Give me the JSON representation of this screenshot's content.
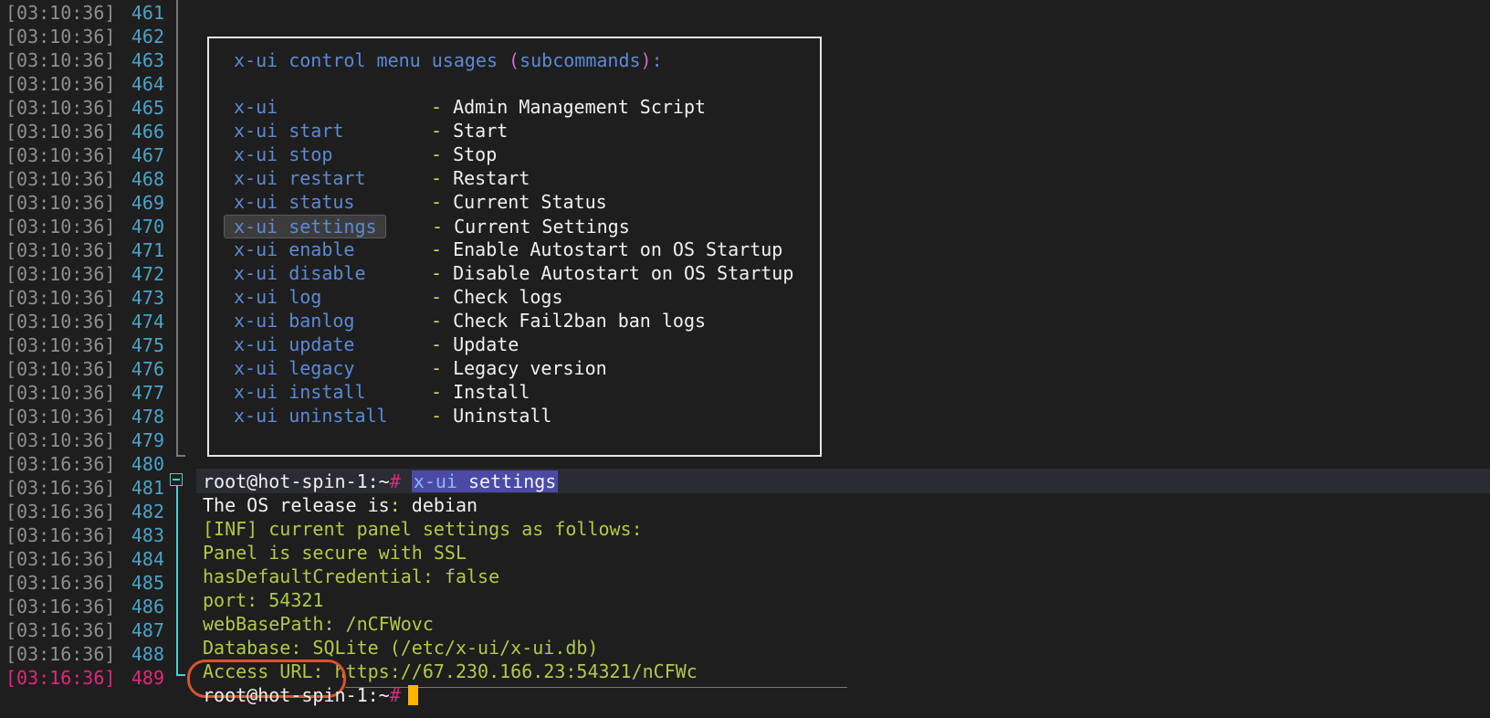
{
  "timestamps": {
    "old": "[03:10:36]",
    "new": "[03:16:36]"
  },
  "line_numbers": [
    "461",
    "462",
    "463",
    "464",
    "465",
    "466",
    "467",
    "468",
    "469",
    "470",
    "471",
    "472",
    "473",
    "474",
    "475",
    "476",
    "477",
    "478",
    "479",
    "480",
    "481",
    "482",
    "483",
    "484",
    "485",
    "486",
    "487",
    "488",
    "489"
  ],
  "menu": {
    "title_prefix": "x-ui control menu usages ",
    "title_paren_open": "(",
    "title_sub": "subcommands",
    "title_paren_close": ")",
    "title_colon": ":",
    "dash": "- ",
    "items": [
      {
        "cmd": "x-ui",
        "desc": "Admin Management Script"
      },
      {
        "cmd": "x-ui start",
        "desc": "Start"
      },
      {
        "cmd": "x-ui stop",
        "desc": "Stop"
      },
      {
        "cmd": "x-ui restart",
        "desc": "Restart"
      },
      {
        "cmd": "x-ui status",
        "desc": "Current Status"
      },
      {
        "cmd": "x-ui settings",
        "desc": "Current Settings"
      },
      {
        "cmd": "x-ui enable",
        "desc": "Enable Autostart on OS Startup"
      },
      {
        "cmd": "x-ui disable",
        "desc": "Disable Autostart on OS Startup"
      },
      {
        "cmd": "x-ui log",
        "desc": "Check logs"
      },
      {
        "cmd": "x-ui banlog",
        "desc": "Check Fail2ban ban logs"
      },
      {
        "cmd": "x-ui update",
        "desc": "Update"
      },
      {
        "cmd": "x-ui legacy",
        "desc": "Legacy version"
      },
      {
        "cmd": "x-ui install",
        "desc": "Install"
      },
      {
        "cmd": "x-ui uninstall",
        "desc": "Uninstall"
      }
    ]
  },
  "prompt": {
    "user_host": "root@hot-spin-1:~",
    "hash": "#",
    "command_prefix": "x-ui",
    "command_arg": " settings"
  },
  "output": {
    "os_label": "The OS release is",
    "os_colon": ":",
    "os_value": " debian",
    "inf": "[INF] current panel settings as follows:",
    "ssl": "Panel is secure with SSL",
    "cred": "hasDefaultCredential: false",
    "port": "port: 54321",
    "webbase": "webBasePath: /nCFWovc",
    "database": "Database: SQLite (/etc/x-ui/x-ui.db)",
    "access_label": "Access URL:",
    "access_value": " https://67.230.166.23:54321/nCFWc"
  },
  "final_prompt": {
    "user_host": "root@hot-spin-1:~",
    "hash": "#"
  },
  "colors": {
    "accent_cmd": "#5b8ad6",
    "output_green": "#b0c94a",
    "cursor": "#ffb400",
    "annotation_circle": "#d9532e"
  }
}
